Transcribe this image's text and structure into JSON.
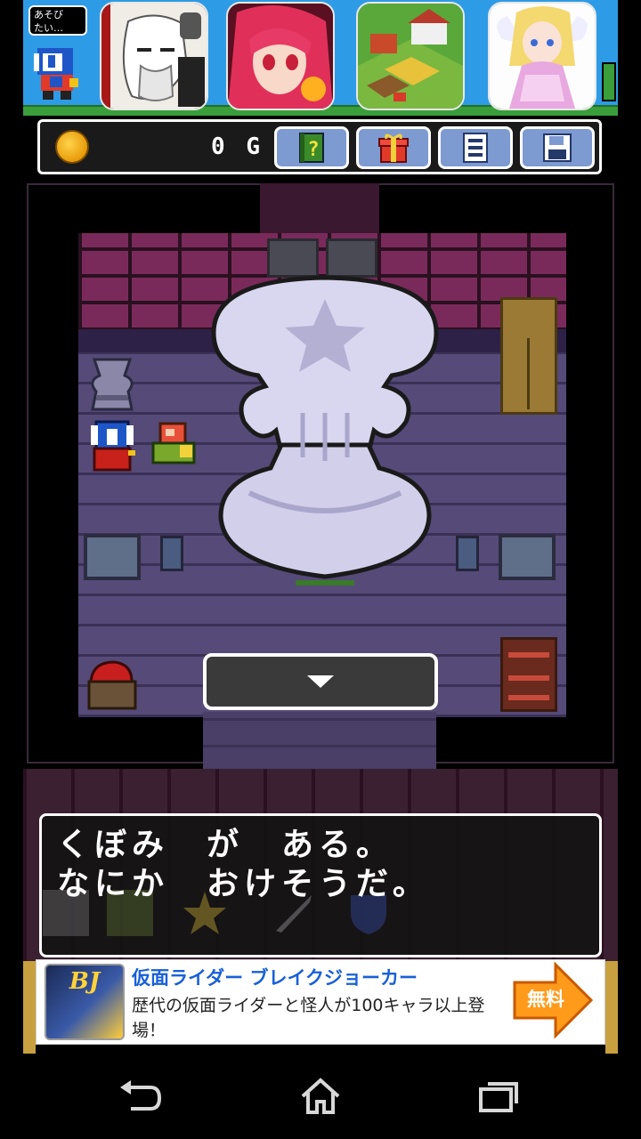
{
  "promo": {
    "bubble_text": "あそび\nたい…",
    "apps": [
      {
        "name": "old-man-manga-app"
      },
      {
        "name": "red-hair-girl-app"
      },
      {
        "name": "farm-game-app"
      },
      {
        "name": "angel-girl-app"
      }
    ]
  },
  "toolbar": {
    "gold": "0 G",
    "buttons": [
      "hint-book",
      "gift",
      "menu-list",
      "save"
    ]
  },
  "dialog": {
    "line1": "くぼみ　が　ある。",
    "line2": "なにか　おけそうだ。"
  },
  "ad": {
    "icon_label": "BJ",
    "title": "仮面ライダー ブレイクジョーカー",
    "description": "歴代の仮面ライダーと怪人が100キャラ以上登場！",
    "badge": "無料"
  },
  "nav": {
    "buttons": [
      "back",
      "home",
      "recent-apps"
    ]
  },
  "colors": {
    "promo_bg": "#2e9be6",
    "toolbar_btn": "#7d9ad1",
    "floor": "#554a78",
    "brick": "#7a2a5a",
    "statue": "#d9d6ef",
    "ad_title": "#1860d8",
    "free_badge": "#ff9a1a"
  }
}
